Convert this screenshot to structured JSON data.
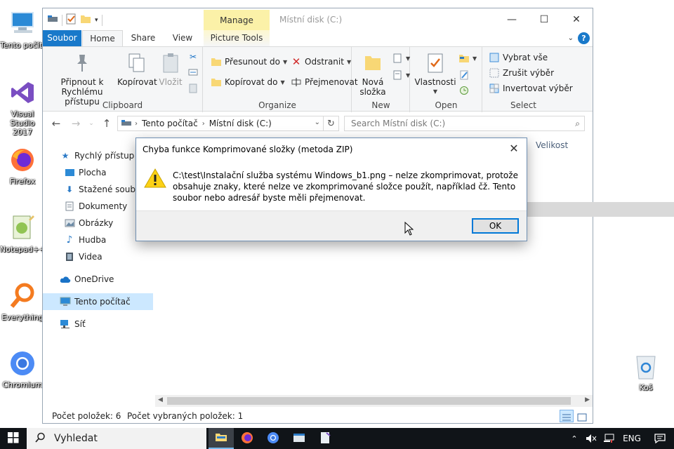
{
  "desktop": {
    "icons": [
      {
        "label": "Tento počítač",
        "icon": "computer-icon"
      },
      {
        "label": "Visual Studio 2017",
        "icon": "visual-studio-icon"
      },
      {
        "label": "Firefox",
        "icon": "firefox-icon"
      },
      {
        "label": "Notepad++",
        "icon": "notepad-plus-plus-icon"
      },
      {
        "label": "Everything",
        "icon": "everything-search-icon"
      },
      {
        "label": "Chromium",
        "icon": "chromium-icon"
      },
      {
        "label": "Koš",
        "icon": "recycle-bin-icon"
      }
    ]
  },
  "explorer": {
    "title": "Místní disk (C:)",
    "contextual_tab": "Manage",
    "tabs": {
      "file": "Soubor",
      "home": "Home",
      "share": "Share",
      "view": "View",
      "picture_tools": "Picture Tools"
    },
    "ribbon": {
      "clipboard": {
        "label": "Clipboard",
        "pin": "Připnout k Rychlému přístupu",
        "copy": "Kopírovat",
        "paste": "Vložit"
      },
      "organize": {
        "label": "Organize",
        "move_to": "Přesunout do",
        "copy_to": "Kopírovat do",
        "delete": "Odstranit",
        "rename": "Přejmenovat"
      },
      "new": {
        "label": "New",
        "new_folder": "Nová složka"
      },
      "open": {
        "label": "Open",
        "properties": "Vlastnosti"
      },
      "select": {
        "label": "Select",
        "select_all": "Vybrat vše",
        "select_none": "Zrušit výběr",
        "invert": "Invertovat výběr"
      }
    },
    "address": {
      "root": "Tento počítač",
      "current": "Místní disk (C:)"
    },
    "search_placeholder": "Search Místní disk (C:)",
    "nav": {
      "quick_access": "Rychlý přístup",
      "desktop": "Plocha",
      "downloads": "Stažené soubory",
      "documents": "Dokumenty",
      "pictures": "Obrázky",
      "music": "Hudba",
      "videos": "Videa",
      "onedrive": "OneDrive",
      "this_pc": "Tento počítač",
      "network": "Síť"
    },
    "column_size": "Velikost",
    "status": {
      "items": "Počet položek: 6",
      "selected": "Počet vybraných položek: 1"
    }
  },
  "dialog": {
    "title": "Chyba funkce Komprimované složky (metoda ZIP)",
    "message": "C:\\test\\Instalační služba systému Windows_b1.png – nelze zkomprimovat, protože obsahuje znaky, které nelze ve zkomprimované složce použít, například čž. Tento soubor nebo adresář byste měli přejmenovat.",
    "ok": "OK"
  },
  "taskbar": {
    "search": "Vyhledat",
    "language": "ENG"
  }
}
